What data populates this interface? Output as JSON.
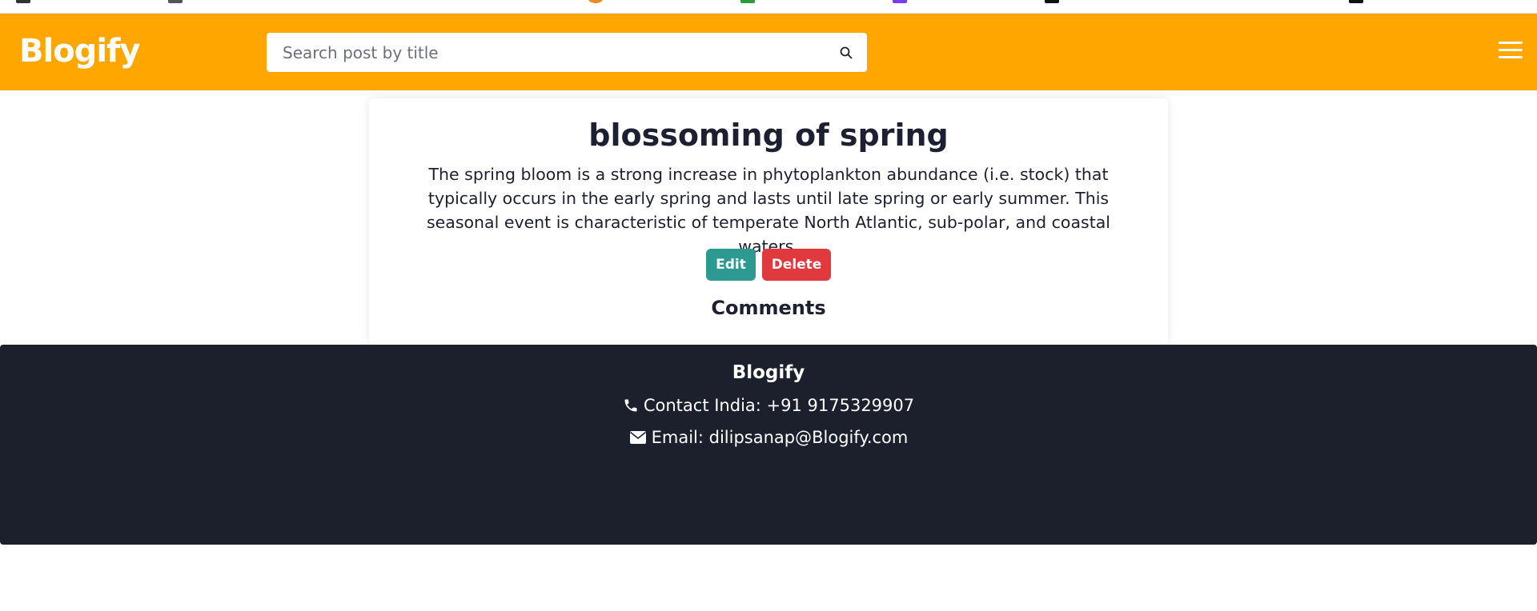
{
  "header": {
    "brand": "Blogify",
    "search": {
      "placeholder": "Search post by title",
      "value": ""
    }
  },
  "post": {
    "title": "blossoming of spring",
    "body": "The spring bloom is a strong increase in phytoplankton abundance (i.e. stock) that typically occurs in the early spring and lasts until late spring or early summer. This seasonal event is characteristic of temperate North Atlantic, sub-polar, and coastal waters.",
    "edit_label": "Edit",
    "delete_label": "Delete",
    "comments_heading": "Comments"
  },
  "footer": {
    "brand": "Blogify",
    "contact": "Contact India: +91 9175329907",
    "email": "Email: dilipsanap@Blogify.com"
  },
  "colors": {
    "header_bg": "#ffa700",
    "edit_button": "#2d9a92",
    "delete_button": "#e03a3e",
    "footer_bg": "#1c202c"
  },
  "icons": {
    "search": "search-icon",
    "menu": "hamburger-menu-icon",
    "phone": "phone-icon",
    "email": "envelope-icon"
  }
}
